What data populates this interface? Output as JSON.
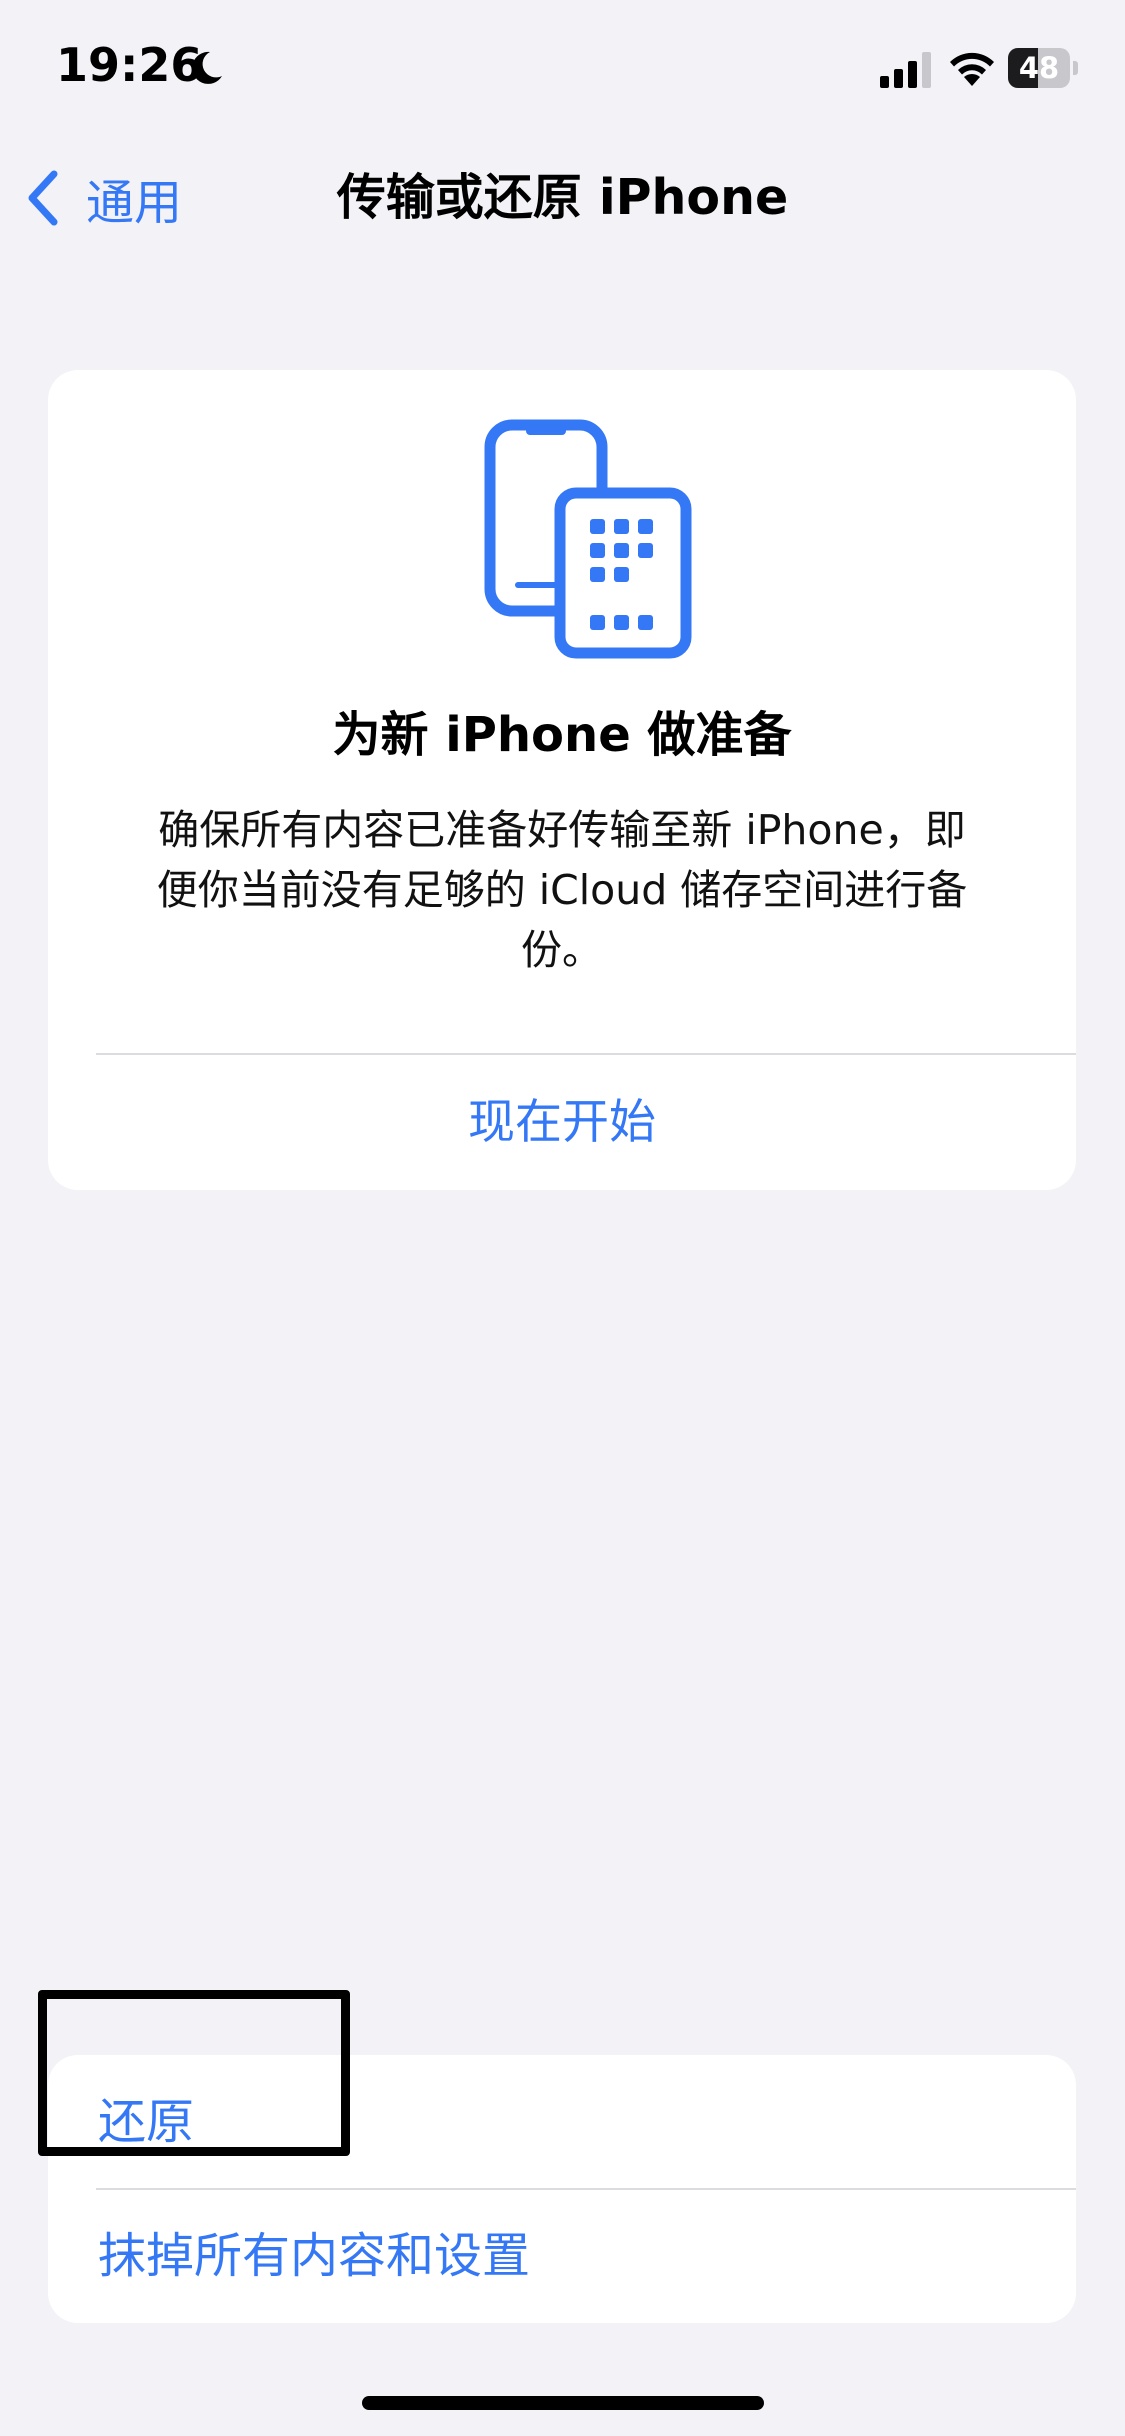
{
  "status_bar": {
    "time": "19:26",
    "battery_level": "48",
    "battery_fraction": 0.48,
    "icons": [
      "moon-icon",
      "signal-icon",
      "wifi-icon",
      "battery-icon"
    ]
  },
  "nav": {
    "back_label": "通用",
    "title": "传输或还原 iPhone",
    "back_icon": "chevron-left-icon"
  },
  "prepare_card": {
    "icon": "transfer-devices-icon",
    "title": "为新 iPhone 做准备",
    "description_lines": [
      "确保所有内容已准备好传输至新 iPhone，即",
      "便你当前没有足够的 iCloud 储存空间进行备",
      "份。"
    ],
    "action_label": "现在开始"
  },
  "reset_group": {
    "items": [
      {
        "label": "还原"
      },
      {
        "label": "抹掉所有内容和设置"
      }
    ]
  },
  "colors": {
    "accent": "#3478f6",
    "background": "#f2f2f7",
    "card": "#ffffff",
    "separator": "#dcdce0"
  }
}
